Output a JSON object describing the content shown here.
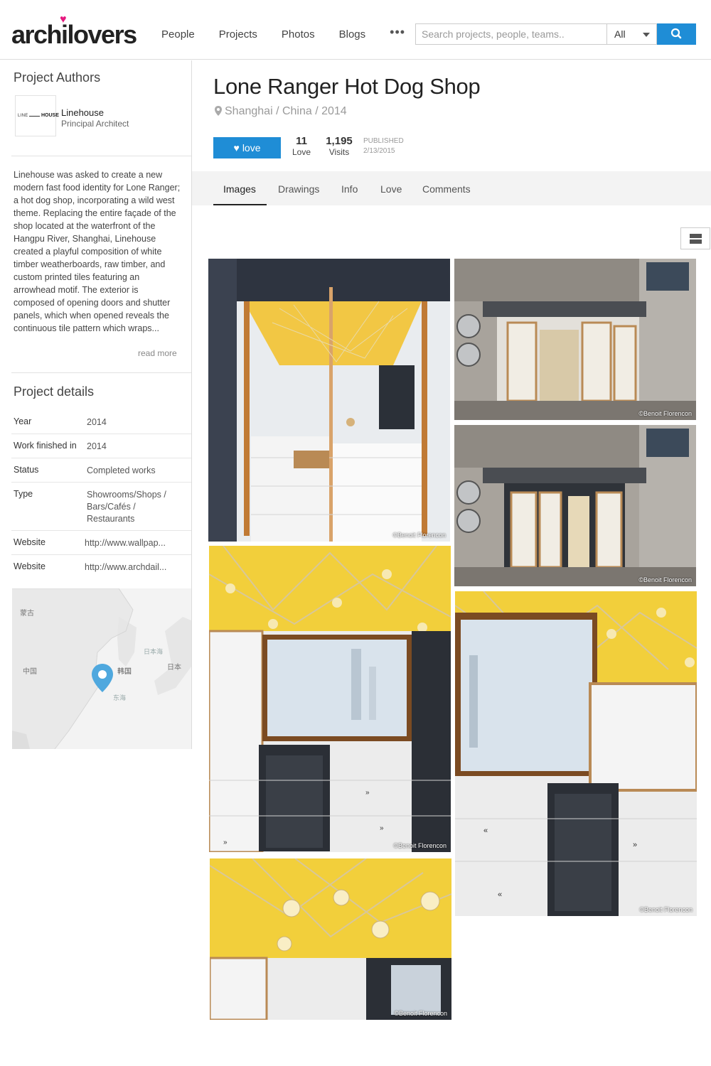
{
  "header": {
    "logo": "archilovers",
    "nav": [
      "People",
      "Projects",
      "Photos",
      "Blogs"
    ],
    "more": "•••",
    "search_placeholder": "Search projects, people, teams..",
    "filter_value": "All",
    "accent_color": "#1f8dd6",
    "logo_heart_color": "#e6197f"
  },
  "sidebar": {
    "authors_title": "Project Authors",
    "author": {
      "logo_text_left": "LINE",
      "logo_text_right": "HOUSE",
      "name": "Linehouse",
      "role": "Principal Architect"
    },
    "description": "Linehouse was asked to create a new modern fast food identity for Lone Ranger; a hot dog shop, incorporating a wild west theme. Replacing the entire façade of the shop located at the waterfront of the Hangpu River, Shanghai, Linehouse created a playful composition of white timber weatherboards, raw timber, and custom printed tiles featuring an arrowhead motif. The exterior is composed of opening doors and shutter panels, which when opened reveals the continuous tile pattern which wraps...",
    "read_more": "read more",
    "details_title": "Project details",
    "details": [
      {
        "key": "Year",
        "value": "2014"
      },
      {
        "key": "Work finished in",
        "value": "2014"
      },
      {
        "key": "Status",
        "value": "Completed works"
      },
      {
        "key": "Type",
        "value": "Showrooms/Shops / Bars/Cafés / Restaurants"
      },
      {
        "key": "Website",
        "value": "http://www.wallpap..."
      },
      {
        "key": "Website",
        "value": "http://www.archdail..."
      }
    ],
    "map_labels": {
      "mongolia": "蒙古",
      "china": "中国",
      "korea": "韩国",
      "japan": "日本",
      "sea_of_japan": "日本海",
      "east_sea": "东海"
    }
  },
  "project": {
    "title": "Lone Ranger Hot Dog Shop",
    "location": "Shanghai / China / 2014",
    "love_button": "love",
    "love_count": "11",
    "love_label": "Love",
    "visits_count": "1,195",
    "visits_label": "Visits",
    "published_label": "PUBLISHED",
    "published_date": "2/13/2015"
  },
  "tabs": [
    "Images",
    "Drawings",
    "Info",
    "Love",
    "Comments"
  ],
  "active_tab": "Images",
  "photo_credit": "©Benoit Florencon"
}
